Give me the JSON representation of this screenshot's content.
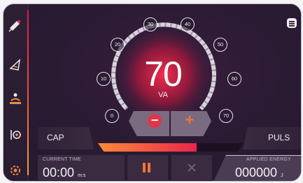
{
  "sidebar": {
    "items": [
      {
        "name": "satellite-icon"
      },
      {
        "name": "cone-icon"
      },
      {
        "name": "person-lying-icon"
      },
      {
        "name": "horn-icon"
      },
      {
        "name": "gear-icon"
      }
    ]
  },
  "gauge": {
    "value": "70",
    "unit": "VA",
    "ticks": [
      "0",
      "10",
      "20",
      "30",
      "40",
      "50",
      "60",
      "70"
    ],
    "level_fraction": 1.0
  },
  "controls": {
    "minus": "−",
    "plus": "+"
  },
  "modes": {
    "left": "CAP",
    "right": "PULS"
  },
  "progress": {
    "fraction": 0.68
  },
  "time": {
    "label": "CURRENT TIME",
    "value": "00:00",
    "unit": "m:s"
  },
  "energy": {
    "label": "APPLIED ENERGY",
    "value": "000000",
    "unit": "J"
  },
  "colors": {
    "accent": "#f07338",
    "accent2": "#e0354a",
    "background": "#2a1d33"
  }
}
